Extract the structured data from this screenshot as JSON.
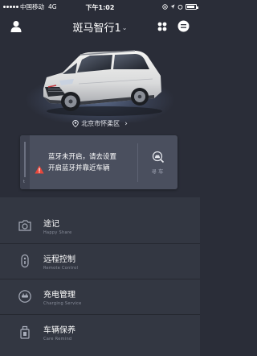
{
  "status_bar": {
    "carrier": "中国移动",
    "network": "4G",
    "time": "下午1:02"
  },
  "header": {
    "title": "斑马智行1",
    "icons": [
      "user-icon",
      "grid-icon",
      "message-icon",
      "chevron-down-icon"
    ]
  },
  "car": {
    "location": "北京市怀柔区"
  },
  "bluetooth_card": {
    "line1": "蓝牙未开启，请去设置",
    "line2": "开启蓝牙并靠近车辆",
    "find_car_label": "寻车",
    "strip_label": "t"
  },
  "menu": {
    "items": [
      {
        "title": "途记",
        "subtitle": "Happy Share",
        "icon": "camera-icon"
      },
      {
        "title": "远程控制",
        "subtitle": "Remote Control",
        "icon": "key-fob-icon"
      },
      {
        "title": "充电管理",
        "subtitle": "Charging Service",
        "icon": "charging-icon"
      },
      {
        "title": "车辆保养",
        "subtitle": "Care Remind",
        "icon": "oil-can-icon"
      }
    ]
  },
  "colors": {
    "background": "#2a2d38",
    "card": "#4a4f5e",
    "menu": "#333742",
    "warning": "#e8473b"
  }
}
